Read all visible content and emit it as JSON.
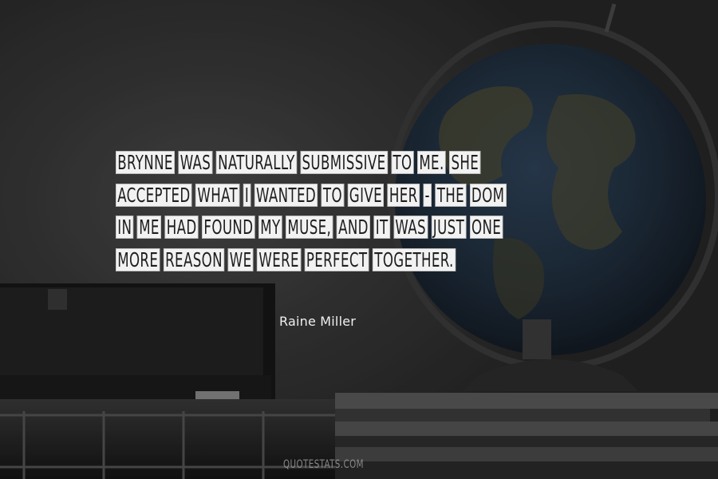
{
  "quote": {
    "lines": [
      [
        "BRYNNE",
        "WAS",
        "NATURALLY",
        "SUBMISSIVE",
        "TO",
        "ME.",
        "SHE"
      ],
      [
        "ACCEPTED",
        "WHAT",
        "I",
        "WANTED",
        "TO",
        "GIVE",
        "HER",
        "-",
        "THE",
        "DOM"
      ],
      [
        "IN",
        "ME",
        "HAD",
        "FOUND",
        "MY",
        "MUSE,",
        "AND",
        "IT",
        "WAS",
        "JUST",
        "ONE"
      ],
      [
        "MORE",
        "REASON",
        "WE",
        "WERE",
        "PERFECT",
        "TOGETHER."
      ]
    ]
  },
  "author": "Raine Miller",
  "watermark": "QUOTESTATS.COM",
  "colors": {
    "background": "#2c2c2c",
    "word_box": "#f2f2f2",
    "quote_text": "#1e1e1e",
    "author_text": "#f0f0f0",
    "globe_ocean": "#243446",
    "globe_land": "#4a4a36"
  },
  "scene": {
    "icons": [
      "globe-icon",
      "printer-device",
      "book-stack"
    ]
  }
}
